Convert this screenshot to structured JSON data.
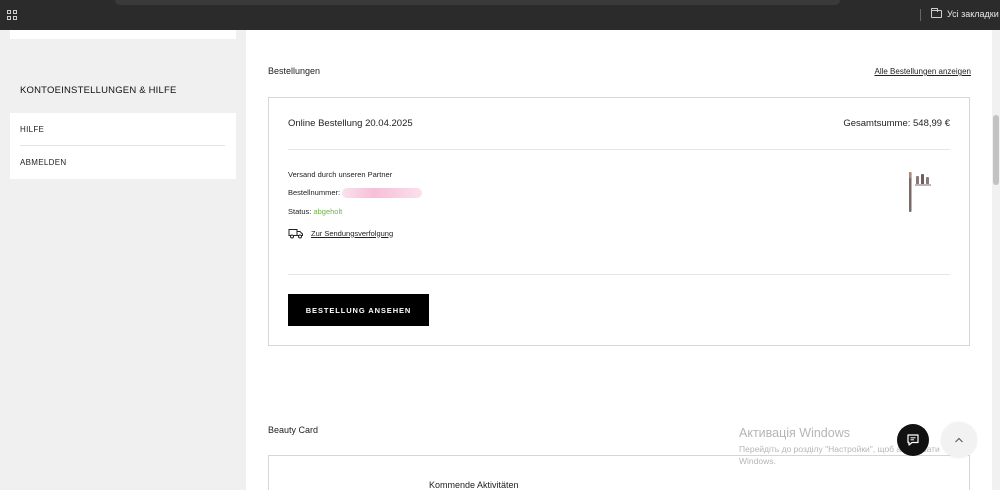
{
  "browser": {
    "bookmarks_label": "Усі закладки"
  },
  "sidebar": {
    "section_title": "KONTOEINSTELLUNGEN & HILFE",
    "items": [
      {
        "label": "HILFE"
      },
      {
        "label": "ABMELDEN"
      }
    ]
  },
  "orders": {
    "title": "Bestellungen",
    "all_link": "Alle Bestellungen anzeigen",
    "order": {
      "title": "Online Bestellung 20.04.2025",
      "total": "Gesamtsumme: 548,99 €",
      "shipping": "Versand durch unseren Partner",
      "order_number_label": "Bestellnummer:",
      "status_label": "Status:",
      "status_value": "abgeholt",
      "tracking_link": "Zur Sendungsverfolgung",
      "view_button": "BESTELLUNG ANSEHEN"
    }
  },
  "beauty_card": {
    "title": "Beauty Card",
    "upcoming": "Kommende Aktivitäten"
  },
  "watermark": {
    "title": "Активація Windows",
    "subtitle": "Перейдіть до розділу \"Настройки\", щоб активувати Windows."
  },
  "colors": {
    "status_green": "#6fb34b",
    "button_black": "#000000",
    "redaction_pink": "#f6bfd8"
  },
  "icons": {
    "apps": "apps-grid-icon",
    "bookmarks": "folder-icon",
    "tracking": "truck-icon",
    "chat": "chat-icon",
    "scroll_top": "chevron-up-icon"
  }
}
